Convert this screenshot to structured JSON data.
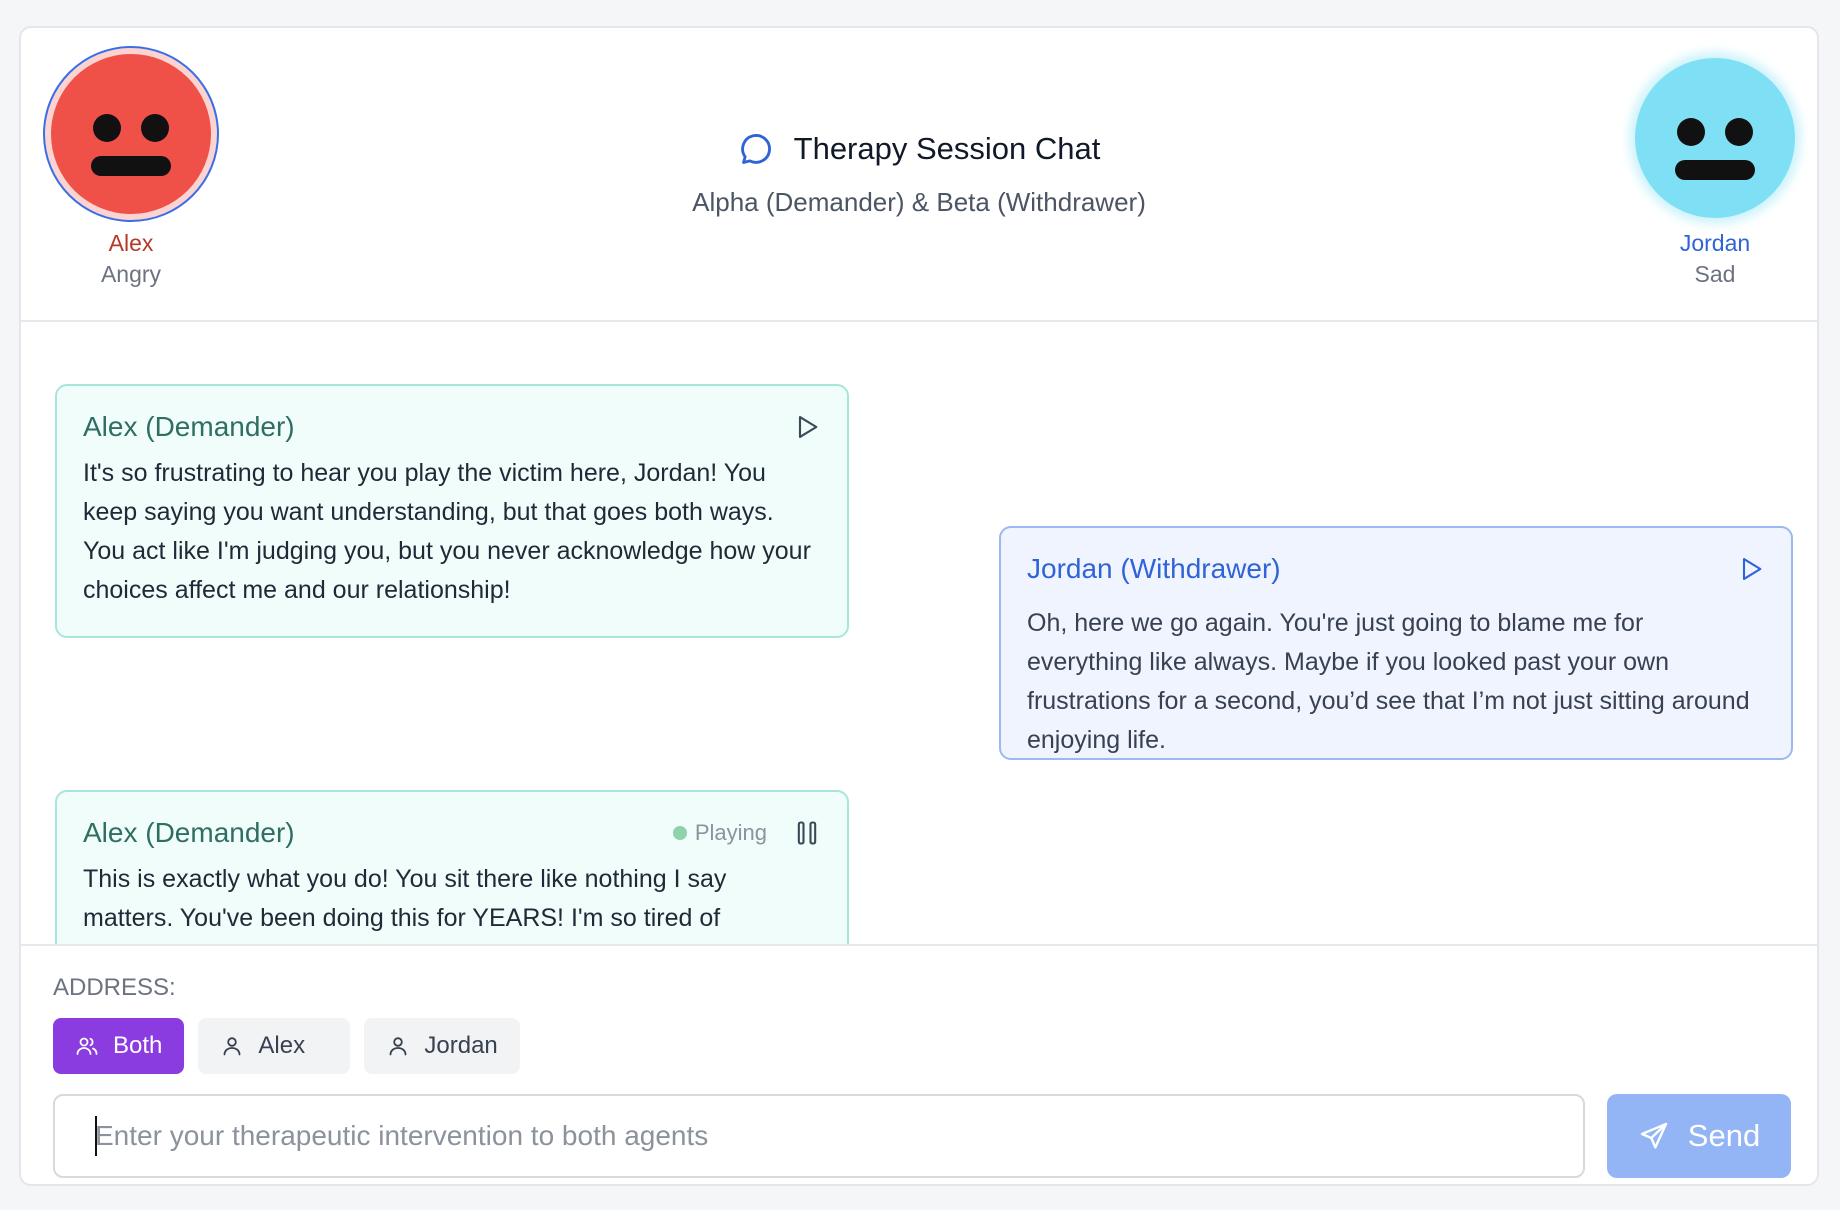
{
  "header": {
    "title": "Therapy Session Chat",
    "subtitle": "Alpha (Demander) & Beta (Withdrawer)",
    "left_agent": {
      "name": "Alex",
      "emotion": "Angry",
      "color": "#ef5148"
    },
    "right_agent": {
      "name": "Jordan",
      "emotion": "Sad",
      "color": "#7fe0f5"
    }
  },
  "messages": [
    {
      "speaker": "Alex (Demander)",
      "text": "It's so frustrating to hear you play the victim here, Jordan! You keep saying  you want understanding, but that goes both ways. You act like I'm judging you, but you never acknowledge how your choices affect me and our relationship!",
      "control": "play-icon"
    },
    {
      "speaker": "Jordan (Withdrawer)",
      "text": "Oh, here we go again. You're just going to blame me for everything like always. Maybe if you looked past your own frustrations for a second, you’d see that I’m not just sitting around enjoying life.",
      "control": "play-icon"
    },
    {
      "speaker": "Alex (Demander)",
      "status": "Playing",
      "text": "This is exactly what you do! You sit there like nothing I say matters. You've been doing this for YEARS! I'm so tired of",
      "control": "pause-icon"
    }
  ],
  "footer": {
    "address_label": "ADDRESS:",
    "address_options": [
      {
        "label": "Both",
        "icon": "users-icon",
        "active": true
      },
      {
        "label": "Alex",
        "icon": "user-icon",
        "active": false
      },
      {
        "label": "Jordan",
        "icon": "user-icon",
        "active": false
      }
    ],
    "input_placeholder": "Enter your therapeutic intervention to both agents",
    "send_label": "Send",
    "accent_color": "#8a3ce0",
    "send_color": "#93b4f5"
  }
}
